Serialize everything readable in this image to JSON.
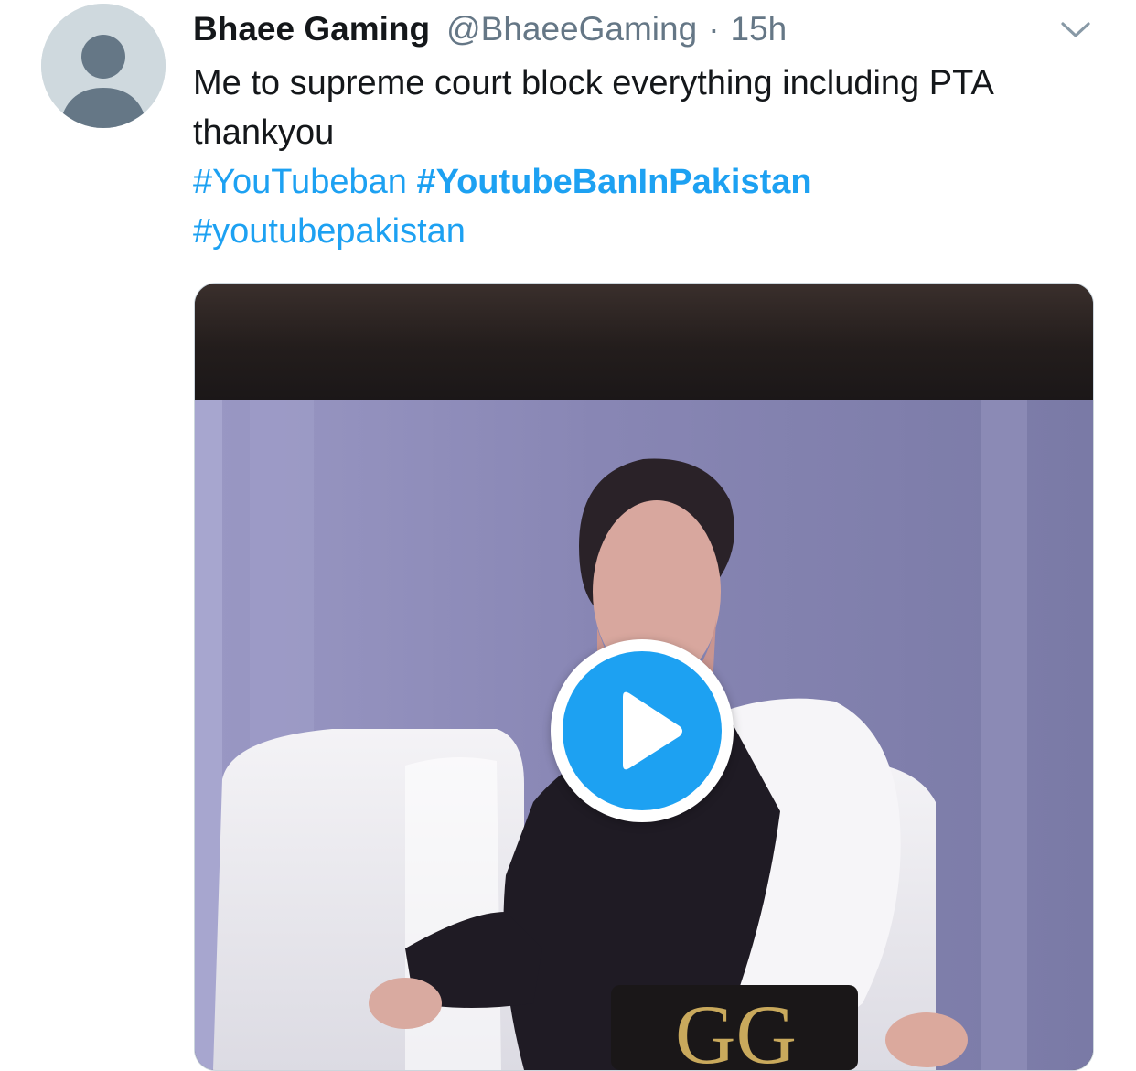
{
  "tweet": {
    "display_name": "Bhaee Gaming",
    "handle": "@BhaeeGaming",
    "separator": "·",
    "timestamp": "15h",
    "text_line1": "Me to supreme court block everything including PTA thankyou",
    "hashtags": [
      "#YouTubeban",
      "#YoutubeBanInPakistan",
      "#youtubepakistan"
    ]
  },
  "icons": {
    "avatar": "default-profile-avatar",
    "menu": "chevron-down-icon",
    "play": "play-icon"
  },
  "colors": {
    "accent": "#1da1f2",
    "text": "#14171a",
    "secondary": "#657786",
    "avatar_bg": "#cfd9de"
  }
}
